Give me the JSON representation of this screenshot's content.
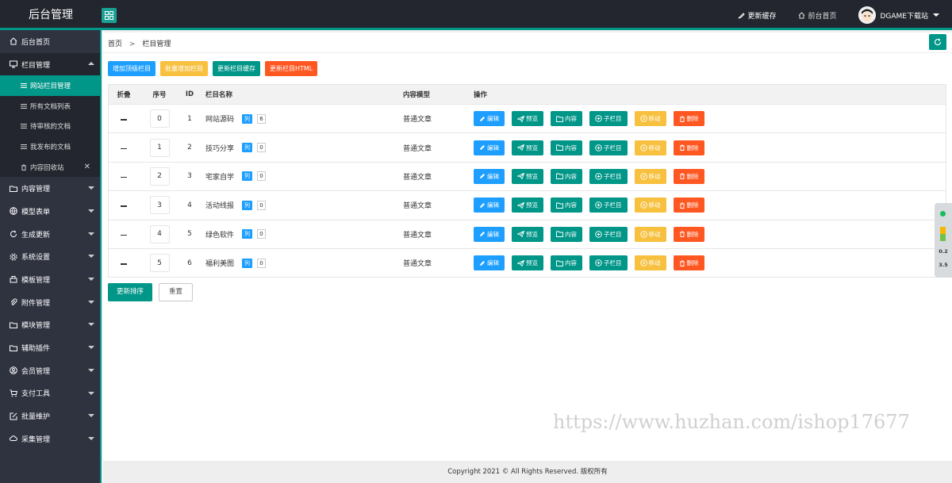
{
  "header": {
    "logo": "后台管理",
    "update_cache": "更新缓存",
    "front_home": "前台首页",
    "user_name": "DGAME下载站"
  },
  "sidebar": {
    "items": [
      {
        "label": "后台首页",
        "icon": "home-icon"
      },
      {
        "label": "栏目管理",
        "icon": "monitor-icon"
      },
      {
        "label": "内容管理",
        "icon": "folder-icon"
      },
      {
        "label": "模型表单",
        "icon": "globe-icon"
      },
      {
        "label": "生成更新",
        "icon": "refresh-icon"
      },
      {
        "label": "系统设置",
        "icon": "gear-icon"
      },
      {
        "label": "模板管理",
        "icon": "template-icon"
      },
      {
        "label": "附件管理",
        "icon": "paperclip-icon"
      },
      {
        "label": "模块管理",
        "icon": "folder-icon"
      },
      {
        "label": "辅助插件",
        "icon": "folder-icon"
      },
      {
        "label": "会员管理",
        "icon": "user-icon"
      },
      {
        "label": "支付工具",
        "icon": "cart-icon"
      },
      {
        "label": "批量维护",
        "icon": "edit-box-icon"
      },
      {
        "label": "采集管理",
        "icon": "cloud-icon"
      }
    ],
    "sub_items": [
      {
        "label": "网站栏目管理"
      },
      {
        "label": "所有文档列表"
      },
      {
        "label": "待审核的文档"
      },
      {
        "label": "我发布的文档"
      },
      {
        "label": "内容回收站"
      }
    ]
  },
  "breadcrumb": {
    "home": "首页",
    "separator": ">",
    "current": "栏目管理"
  },
  "toolbar": {
    "add_top": "增加顶级栏目",
    "batch_add": "批量增加栏目",
    "update_cache": "更新栏目缓存",
    "update_html": "更新栏目HTML"
  },
  "table": {
    "headers": {
      "fold": "折叠",
      "sort": "序号",
      "id": "ID",
      "name": "栏目名称",
      "model": "内容模型",
      "ops": "操作"
    },
    "list_badge": "列",
    "ops": {
      "edit": "编辑",
      "preview": "预览",
      "content": "内容",
      "child": "子栏目",
      "move": "移动",
      "delete": "删除"
    },
    "rows": [
      {
        "sort": "0",
        "id": "1",
        "name": "网站源码",
        "count": "6",
        "model": "普通文章"
      },
      {
        "sort": "1",
        "id": "2",
        "name": "技巧分享",
        "count": "0",
        "model": "普通文章"
      },
      {
        "sort": "2",
        "id": "3",
        "name": "宅家自学",
        "count": "0",
        "model": "普通文章"
      },
      {
        "sort": "3",
        "id": "4",
        "name": "活动线报",
        "count": "0",
        "model": "普通文章"
      },
      {
        "sort": "4",
        "id": "5",
        "name": "绿色软件",
        "count": "0",
        "model": "普通文章"
      },
      {
        "sort": "5",
        "id": "6",
        "name": "福利美图",
        "count": "0",
        "model": "普通文章"
      }
    ]
  },
  "actions": {
    "update_sort": "更新排序",
    "reset": "重置"
  },
  "footer": {
    "copyright": "Copyright 2021 © All Rights Reserved. 版权所有"
  },
  "watermark": "https://www.huzhan.com/ishop17677",
  "widget": {
    "v1": "0.2",
    "v2": "3.5"
  },
  "colors": {
    "accent": "#009688",
    "blue": "#1e9fff",
    "yellow": "#f7c03e",
    "red": "#ff5722",
    "sidebar": "#2f3340",
    "topbar": "#23262e"
  }
}
